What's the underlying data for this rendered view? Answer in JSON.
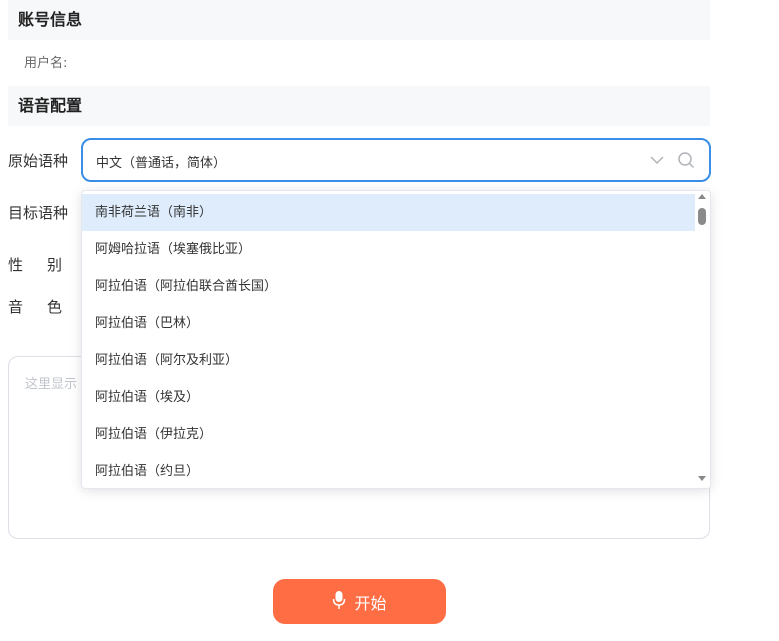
{
  "account": {
    "title": "账号信息",
    "username_label": "用户名:"
  },
  "voice": {
    "title": "语音配置",
    "source_label": "原始语种",
    "source_value": "中文（普通话，简体）",
    "target_label": "目标语种",
    "gender_label": "性别",
    "timbre_label": "音色"
  },
  "dropdown": {
    "options": [
      "南非荷兰语（南非）",
      "阿姆哈拉语（埃塞俄比亚）",
      "阿拉伯语（阿拉伯联合酋长国）",
      "阿拉伯语（巴林）",
      "阿拉伯语（阿尔及利亚）",
      "阿拉伯语（埃及）",
      "阿拉伯语（伊拉克）",
      "阿拉伯语（约旦）"
    ]
  },
  "textarea": {
    "placeholder": "这里显示"
  },
  "start_button": {
    "label": "开始"
  },
  "colors": {
    "accent": "#3a8ee6",
    "button": "#ff6d45",
    "highlight": "#dfecfc"
  },
  "icons": {
    "chevron": "chevron-down-icon",
    "search": "search-icon",
    "mic": "microphone-icon"
  }
}
